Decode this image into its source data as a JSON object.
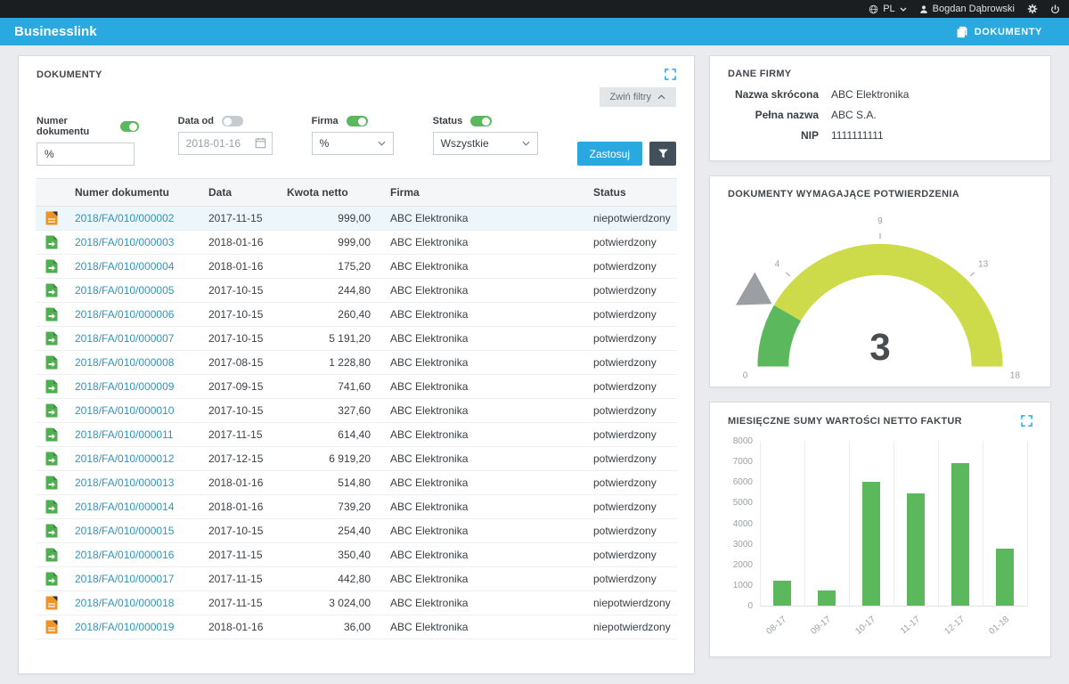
{
  "topbar": {
    "lang": "PL",
    "user": "Bogdan Dąbrowski"
  },
  "navbar": {
    "brand": "Businesslink",
    "nav_label": "DOKUMENTY"
  },
  "documents_panel": {
    "title": "DOKUMENTY",
    "collapse_filters_label": "Zwiń filtry",
    "filters": {
      "numer": {
        "label": "Numer dokumentu",
        "value": "%",
        "enabled": true
      },
      "data_od": {
        "label": "Data od",
        "value": "2018-01-16",
        "enabled": false
      },
      "firma": {
        "label": "Firma",
        "value": "%",
        "enabled": true
      },
      "status": {
        "label": "Status",
        "value": "Wszystkie",
        "enabled": true
      },
      "apply_label": "Zastosuj"
    },
    "table": {
      "headers": [
        "Numer dokumentu",
        "Data",
        "Kwota netto",
        "Firma",
        "Status"
      ],
      "rows": [
        {
          "number": "2018/FA/010/000002",
          "date": "2017-11-15",
          "amount": "999,00",
          "company": "ABC Elektronika",
          "status": "niepotwierdzony",
          "status_type": "unconfirmed",
          "highlighted": true
        },
        {
          "number": "2018/FA/010/000003",
          "date": "2018-01-16",
          "amount": "999,00",
          "company": "ABC Elektronika",
          "status": "potwierdzony",
          "status_type": "confirmed",
          "highlighted": false
        },
        {
          "number": "2018/FA/010/000004",
          "date": "2018-01-16",
          "amount": "175,20",
          "company": "ABC Elektronika",
          "status": "potwierdzony",
          "status_type": "confirmed",
          "highlighted": false
        },
        {
          "number": "2018/FA/010/000005",
          "date": "2017-10-15",
          "amount": "244,80",
          "company": "ABC Elektronika",
          "status": "potwierdzony",
          "status_type": "confirmed",
          "highlighted": false
        },
        {
          "number": "2018/FA/010/000006",
          "date": "2017-10-15",
          "amount": "260,40",
          "company": "ABC Elektronika",
          "status": "potwierdzony",
          "status_type": "confirmed",
          "highlighted": false
        },
        {
          "number": "2018/FA/010/000007",
          "date": "2017-10-15",
          "amount": "5 191,20",
          "company": "ABC Elektronika",
          "status": "potwierdzony",
          "status_type": "confirmed",
          "highlighted": false
        },
        {
          "number": "2018/FA/010/000008",
          "date": "2017-08-15",
          "amount": "1 228,80",
          "company": "ABC Elektronika",
          "status": "potwierdzony",
          "status_type": "confirmed",
          "highlighted": false
        },
        {
          "number": "2018/FA/010/000009",
          "date": "2017-09-15",
          "amount": "741,60",
          "company": "ABC Elektronika",
          "status": "potwierdzony",
          "status_type": "confirmed",
          "highlighted": false
        },
        {
          "number": "2018/FA/010/000010",
          "date": "2017-10-15",
          "amount": "327,60",
          "company": "ABC Elektronika",
          "status": "potwierdzony",
          "status_type": "confirmed",
          "highlighted": false
        },
        {
          "number": "2018/FA/010/000011",
          "date": "2017-11-15",
          "amount": "614,40",
          "company": "ABC Elektronika",
          "status": "potwierdzony",
          "status_type": "confirmed",
          "highlighted": false
        },
        {
          "number": "2018/FA/010/000012",
          "date": "2017-12-15",
          "amount": "6 919,20",
          "company": "ABC Elektronika",
          "status": "potwierdzony",
          "status_type": "confirmed",
          "highlighted": false
        },
        {
          "number": "2018/FA/010/000013",
          "date": "2018-01-16",
          "amount": "514,80",
          "company": "ABC Elektronika",
          "status": "potwierdzony",
          "status_type": "confirmed",
          "highlighted": false
        },
        {
          "number": "2018/FA/010/000014",
          "date": "2018-01-16",
          "amount": "739,20",
          "company": "ABC Elektronika",
          "status": "potwierdzony",
          "status_type": "confirmed",
          "highlighted": false
        },
        {
          "number": "2018/FA/010/000015",
          "date": "2017-10-15",
          "amount": "254,40",
          "company": "ABC Elektronika",
          "status": "potwierdzony",
          "status_type": "confirmed",
          "highlighted": false
        },
        {
          "number": "2018/FA/010/000016",
          "date": "2017-11-15",
          "amount": "350,40",
          "company": "ABC Elektronika",
          "status": "potwierdzony",
          "status_type": "confirmed",
          "highlighted": false
        },
        {
          "number": "2018/FA/010/000017",
          "date": "2017-11-15",
          "amount": "442,80",
          "company": "ABC Elektronika",
          "status": "potwierdzony",
          "status_type": "confirmed",
          "highlighted": false
        },
        {
          "number": "2018/FA/010/000018",
          "date": "2017-11-15",
          "amount": "3 024,00",
          "company": "ABC Elektronika",
          "status": "niepotwierdzony",
          "status_type": "unconfirmed",
          "highlighted": false
        },
        {
          "number": "2018/FA/010/000019",
          "date": "2018-01-16",
          "amount": "36,00",
          "company": "ABC Elektronika",
          "status": "niepotwierdzony",
          "status_type": "unconfirmed",
          "highlighted": false
        }
      ]
    }
  },
  "company_panel": {
    "title": "DANE FIRMY",
    "fields": [
      {
        "label": "Nazwa skrócona",
        "value": "ABC Elektronika"
      },
      {
        "label": "Pełna nazwa",
        "value": "ABC S.A."
      },
      {
        "label": "NIP",
        "value": "1111111111"
      }
    ]
  },
  "gauge_panel": {
    "title": "DOKUMENTY WYMAGAJĄCE POTWIERDZENIA"
  },
  "chart_panel": {
    "title": "MIESIĘCZNE SUMY WARTOŚCI NETTO FAKTUR"
  },
  "chart_data": [
    {
      "type": "gauge",
      "title": "DOKUMENTY WYMAGAJĄCE POTWIERDZENIA",
      "value": 3,
      "min": 0,
      "max": 18,
      "tick_labels": [
        "0",
        "4",
        "9",
        "13",
        "18"
      ],
      "segment_colors": {
        "value_segment": "#5cb85c",
        "remainder": "#cdda49"
      }
    },
    {
      "type": "bar",
      "title": "MIESIĘCZNE SUMY WARTOŚCI NETTO FAKTUR",
      "categories": [
        "08-17",
        "09-17",
        "10-17",
        "11-17",
        "12-17",
        "01-18"
      ],
      "values": [
        1229,
        742,
        6024,
        5431,
        6919,
        2770
      ],
      "xlabel": "",
      "ylabel": "",
      "ylim": [
        0,
        8000
      ],
      "y_ticks": [
        0,
        1000,
        2000,
        3000,
        4000,
        5000,
        6000,
        7000,
        8000
      ],
      "bar_color": "#5cb85c",
      "grid": "vertical",
      "legend": "none"
    }
  ],
  "colors": {
    "accent_blue": "#29a9e0",
    "topbar_bg": "#1b1e21",
    "link": "#2d96ba",
    "green": "#5cb85c",
    "gauge_remainder": "#cdda49",
    "funnel_button": "#41505b",
    "highlight_row": "#ecf6fb",
    "unconfirmed_icon": "#ee9426"
  }
}
